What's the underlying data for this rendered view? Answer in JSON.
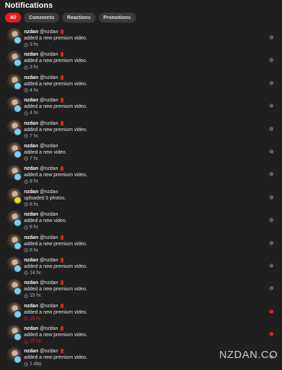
{
  "header": {
    "title": "Notifications"
  },
  "tabs": [
    {
      "label": "All",
      "active": true
    },
    {
      "label": "Comments",
      "active": false
    },
    {
      "label": "Reactions",
      "active": false
    },
    {
      "label": "Promotions",
      "active": false
    }
  ],
  "notifications": [
    {
      "name": "nzdan",
      "handle": "@nzdan",
      "premium": true,
      "action": "added a new premium video.",
      "time": "3 hr.",
      "type": "video",
      "unread": false
    },
    {
      "name": "nzdan",
      "handle": "@nzdan",
      "premium": true,
      "action": "added a new premium video.",
      "time": "3 hr.",
      "type": "video",
      "unread": false
    },
    {
      "name": "nzdan",
      "handle": "@nzdan",
      "premium": true,
      "action": "added a new premium video.",
      "time": "4 hr.",
      "type": "video",
      "unread": false
    },
    {
      "name": "nzdan",
      "handle": "@nzdan",
      "premium": true,
      "action": "added a new premium video.",
      "time": "4 hr.",
      "type": "video",
      "unread": false
    },
    {
      "name": "nzdan",
      "handle": "@nzdan",
      "premium": true,
      "action": "added a new premium video.",
      "time": "7 hr.",
      "type": "video",
      "unread": false
    },
    {
      "name": "nzdan",
      "handle": "@nzdan",
      "premium": false,
      "action": "added a new video.",
      "time": "7 hr.",
      "type": "video",
      "unread": false
    },
    {
      "name": "nzdan",
      "handle": "@nzdan",
      "premium": true,
      "action": "added a new premium video.",
      "time": "8 hr.",
      "type": "video",
      "unread": false
    },
    {
      "name": "nzdan",
      "handle": "@nzdan",
      "premium": false,
      "action": "uploaded 5 photos.",
      "time": "8 hr.",
      "type": "photo",
      "unread": false
    },
    {
      "name": "nzdan",
      "handle": "@nzdan",
      "premium": false,
      "action": "added a new video.",
      "time": "8 hr.",
      "type": "video",
      "unread": false
    },
    {
      "name": "nzdan",
      "handle": "@nzdan",
      "premium": true,
      "action": "added a new premium video.",
      "time": "8 hr.",
      "type": "video",
      "unread": false
    },
    {
      "name": "nzdan",
      "handle": "@nzdan",
      "premium": true,
      "action": "added a new premium video.",
      "time": "14 hr.",
      "type": "video",
      "unread": false
    },
    {
      "name": "nzdan",
      "handle": "@nzdan",
      "premium": true,
      "action": "added a new premium video.",
      "time": "15 hr.",
      "type": "video",
      "unread": false
    },
    {
      "name": "nzdan",
      "handle": "@nzdan",
      "premium": true,
      "action": "added a new premium video.",
      "time": "15 hr.",
      "type": "video",
      "unread": true
    },
    {
      "name": "nzdan",
      "handle": "@nzdan",
      "premium": true,
      "action": "added a new premium video.",
      "time": "15 hr.",
      "type": "video",
      "unread": true
    },
    {
      "name": "nzdan",
      "handle": "@nzdan",
      "premium": true,
      "action": "added a new premium video.",
      "time": "1 day",
      "type": "video",
      "unread": false
    }
  ],
  "watermark": "NZDAN.CO",
  "colors": {
    "accent": "#e01e1e",
    "background": "#1f1f1f",
    "video_badge": "#58b6e0",
    "photo_badge": "#c8c200"
  }
}
